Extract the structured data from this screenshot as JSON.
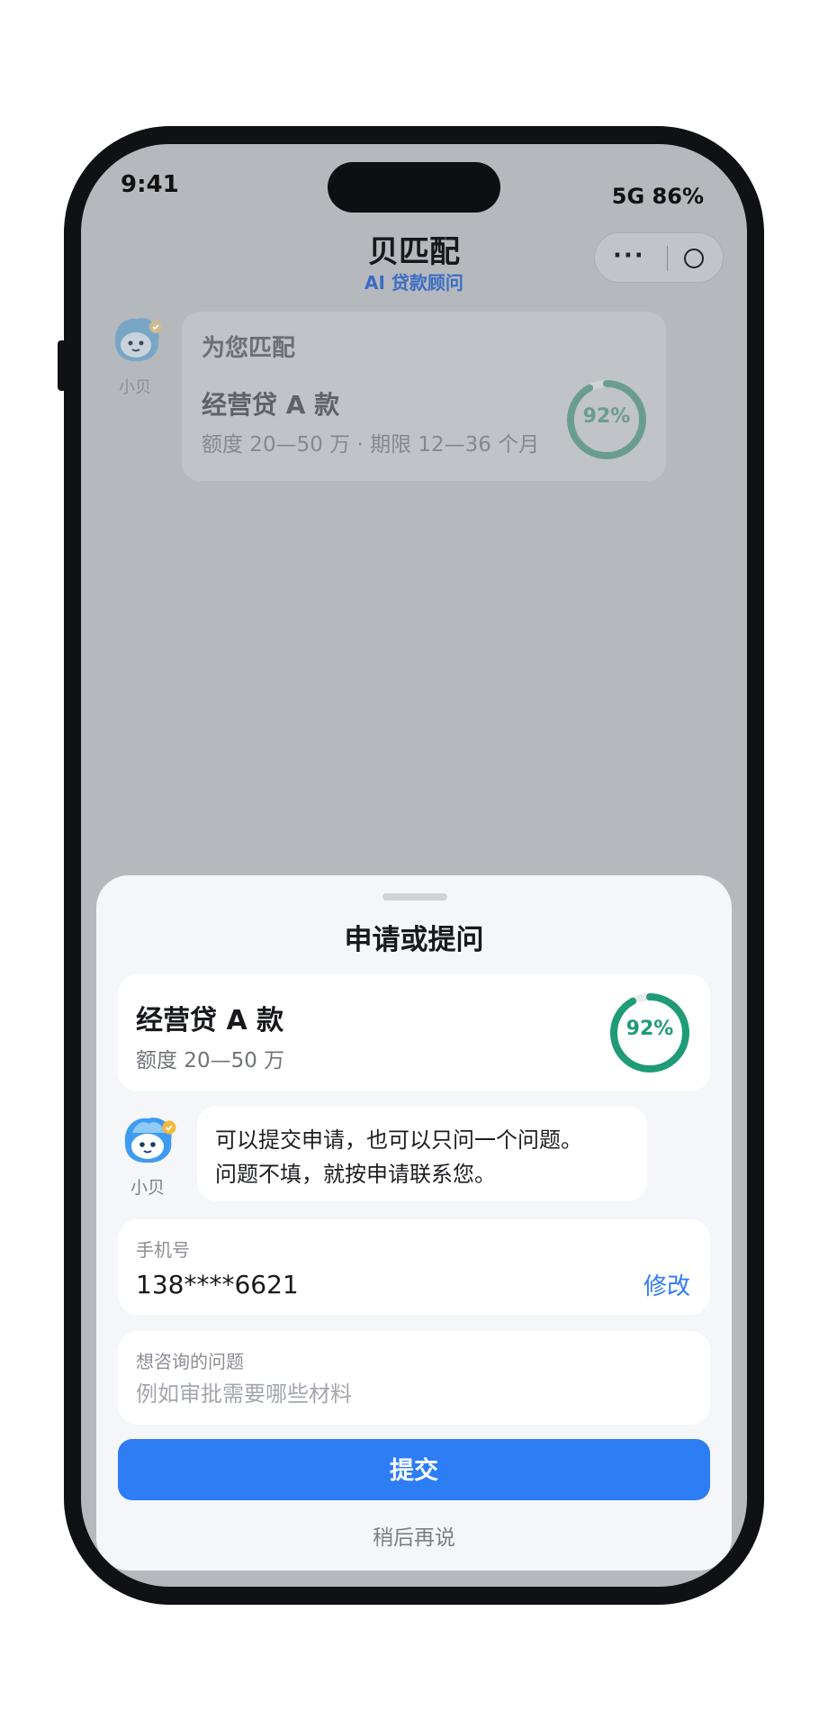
{
  "status_bar": {
    "time": "9:41",
    "network_battery": "5G 86%"
  },
  "header": {
    "title": "贝匹配",
    "subtitle": "AI 贷款顾问"
  },
  "capsule": {
    "more": "···"
  },
  "background_card": {
    "assistant_name": "小贝",
    "heading": "为您匹配",
    "product": "经营贷 A 款",
    "meta": "额度 20—50 万 · 期限 12—36 个月",
    "match": "92%",
    "match_value": 0.92
  },
  "sheet": {
    "title": "申请或提问",
    "product_card": {
      "name": "经营贷 A 款",
      "limit": "额度 20—50 万",
      "match": "92%",
      "match_value": 0.92
    },
    "assistant": {
      "name": "小贝",
      "message_line1": "可以提交申请，也可以只问一个问题。",
      "message_line2": "问题不填，就按申请联系您。"
    },
    "phone_field": {
      "label": "手机号",
      "value": "138****6621",
      "edit": "修改"
    },
    "question_field": {
      "label": "想咨询的问题",
      "placeholder": "例如审批需要哪些材料"
    },
    "submit": "提交",
    "later": "稍后再说"
  },
  "colors": {
    "accent": "#2d7df5",
    "match_green": "#1f9b78",
    "subtitle_blue": "#3b6dc4"
  }
}
